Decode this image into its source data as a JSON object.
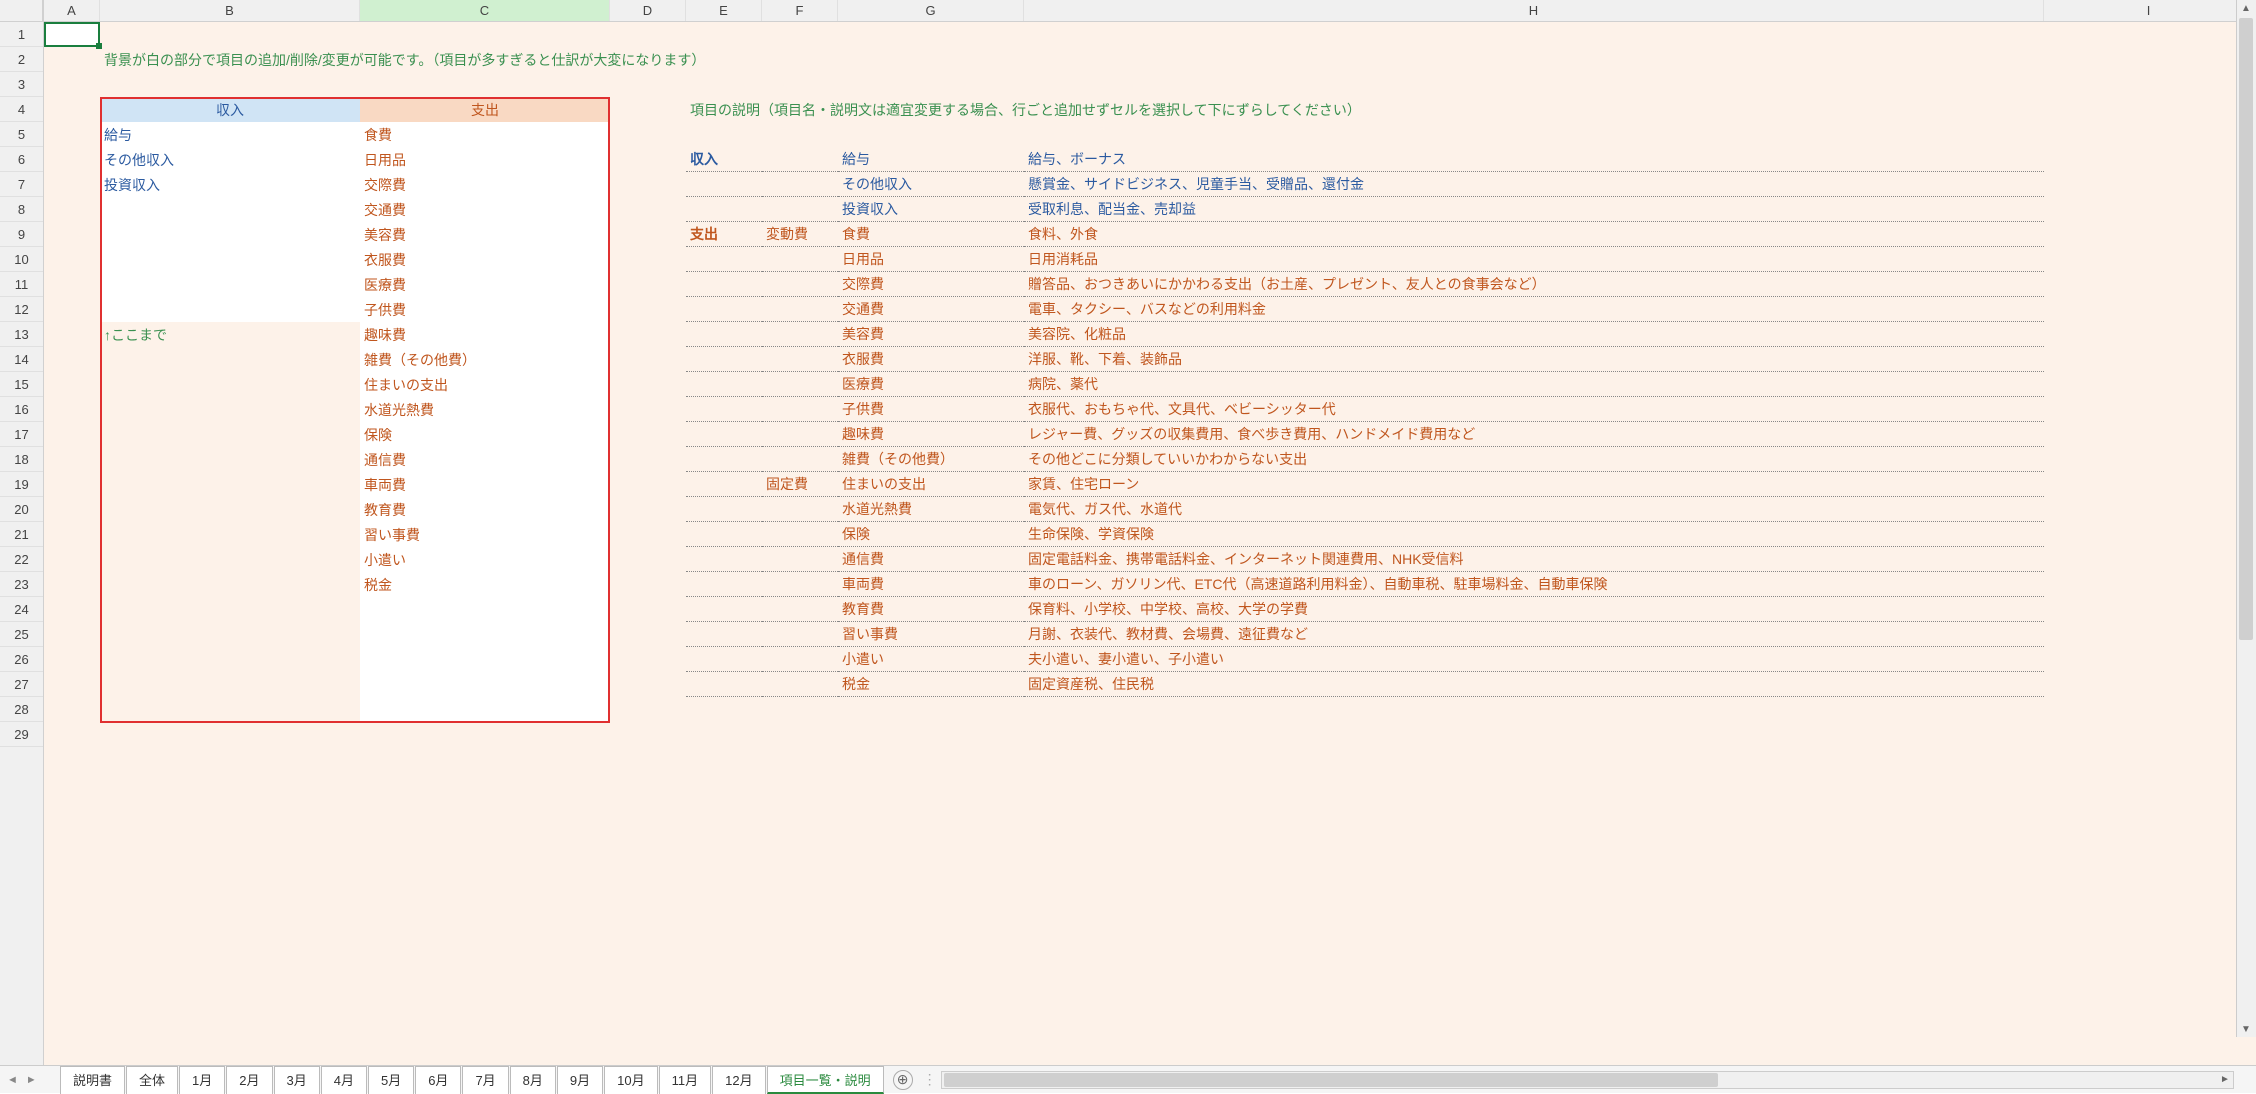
{
  "columns": [
    "A",
    "B",
    "C",
    "D",
    "E",
    "F",
    "G",
    "H",
    "I"
  ],
  "active_column": "C",
  "row_count": 29,
  "selected_cell": "A1",
  "instruction_text": "背景が白の部分で項目の追加/削除/変更が可能です。（項目が多すぎると仕訳が大変になります）",
  "headers": {
    "income": "収入",
    "expense": "支出"
  },
  "income_items": [
    "給与",
    "その他収入",
    "投資収入"
  ],
  "income_note": "↑ここまで",
  "expense_items": [
    "食費",
    "日用品",
    "交際費",
    "交通費",
    "美容費",
    "衣服費",
    "医療費",
    "子供費",
    "趣味費",
    "雑費（その他費）",
    "住まいの支出",
    "水道光熱費",
    "保険",
    "通信費",
    "車両費",
    "教育費",
    "習い事費",
    "小遣い",
    "税金"
  ],
  "explanation_title": "項目の説明（項目名・説明文は適宜変更する場合、行ごと追加せずセルを選択して下にずらしてください）",
  "expl_income_label": "収入",
  "expl_expense_label": "支出",
  "expl_variable_label": "変動費",
  "expl_fixed_label": "固定費",
  "explanations": {
    "income": [
      {
        "name": "給与",
        "desc": "給与、ボーナス"
      },
      {
        "name": "その他収入",
        "desc": "懸賞金、サイドビジネス、児童手当、受贈品、還付金"
      },
      {
        "name": "投資収入",
        "desc": "受取利息、配当金、売却益"
      }
    ],
    "expense_variable": [
      {
        "name": "食費",
        "desc": "食料、外食"
      },
      {
        "name": "日用品",
        "desc": "日用消耗品"
      },
      {
        "name": "交際費",
        "desc": "贈答品、おつきあいにかかわる支出（お土産、プレゼント、友人との食事会など）"
      },
      {
        "name": "交通費",
        "desc": "電車、タクシー、バスなどの利用料金"
      },
      {
        "name": "美容費",
        "desc": "美容院、化粧品"
      },
      {
        "name": "衣服費",
        "desc": "洋服、靴、下着、装飾品"
      },
      {
        "name": "医療費",
        "desc": "病院、薬代"
      },
      {
        "name": "子供費",
        "desc": "衣服代、おもちゃ代、文具代、ベビーシッター代"
      },
      {
        "name": "趣味費",
        "desc": "レジャー費、グッズの収集費用、食べ歩き費用、ハンドメイド費用など"
      },
      {
        "name": "雑費（その他費）",
        "desc": "その他どこに分類していいかわからない支出"
      }
    ],
    "expense_fixed": [
      {
        "name": "住まいの支出",
        "desc": "家賃、住宅ローン"
      },
      {
        "name": "水道光熱費",
        "desc": "電気代、ガス代、水道代"
      },
      {
        "name": "保険",
        "desc": "生命保険、学資保険"
      },
      {
        "name": "通信費",
        "desc": "固定電話料金、携帯電話料金、インターネット関連費用、NHK受信料"
      },
      {
        "name": "車両費",
        "desc": "車のローン、ガソリン代、ETC代（高速道路利用料金）、自動車税、駐車場料金、自動車保険"
      },
      {
        "name": "教育費",
        "desc": "保育料、小学校、中学校、高校、大学の学費"
      },
      {
        "name": "習い事費",
        "desc": "月謝、衣装代、教材費、会場費、遠征費など"
      },
      {
        "name": "小遣い",
        "desc": "夫小遣い、妻小遣い、子小遣い"
      },
      {
        "name": "税金",
        "desc": "固定資産税、住民税"
      }
    ]
  },
  "tabs": [
    "説明書",
    "全体",
    "1月",
    "2月",
    "3月",
    "4月",
    "5月",
    "6月",
    "7月",
    "8月",
    "9月",
    "10月",
    "11月",
    "12月",
    "項目一覧・説明"
  ],
  "active_tab": "項目一覧・説明"
}
